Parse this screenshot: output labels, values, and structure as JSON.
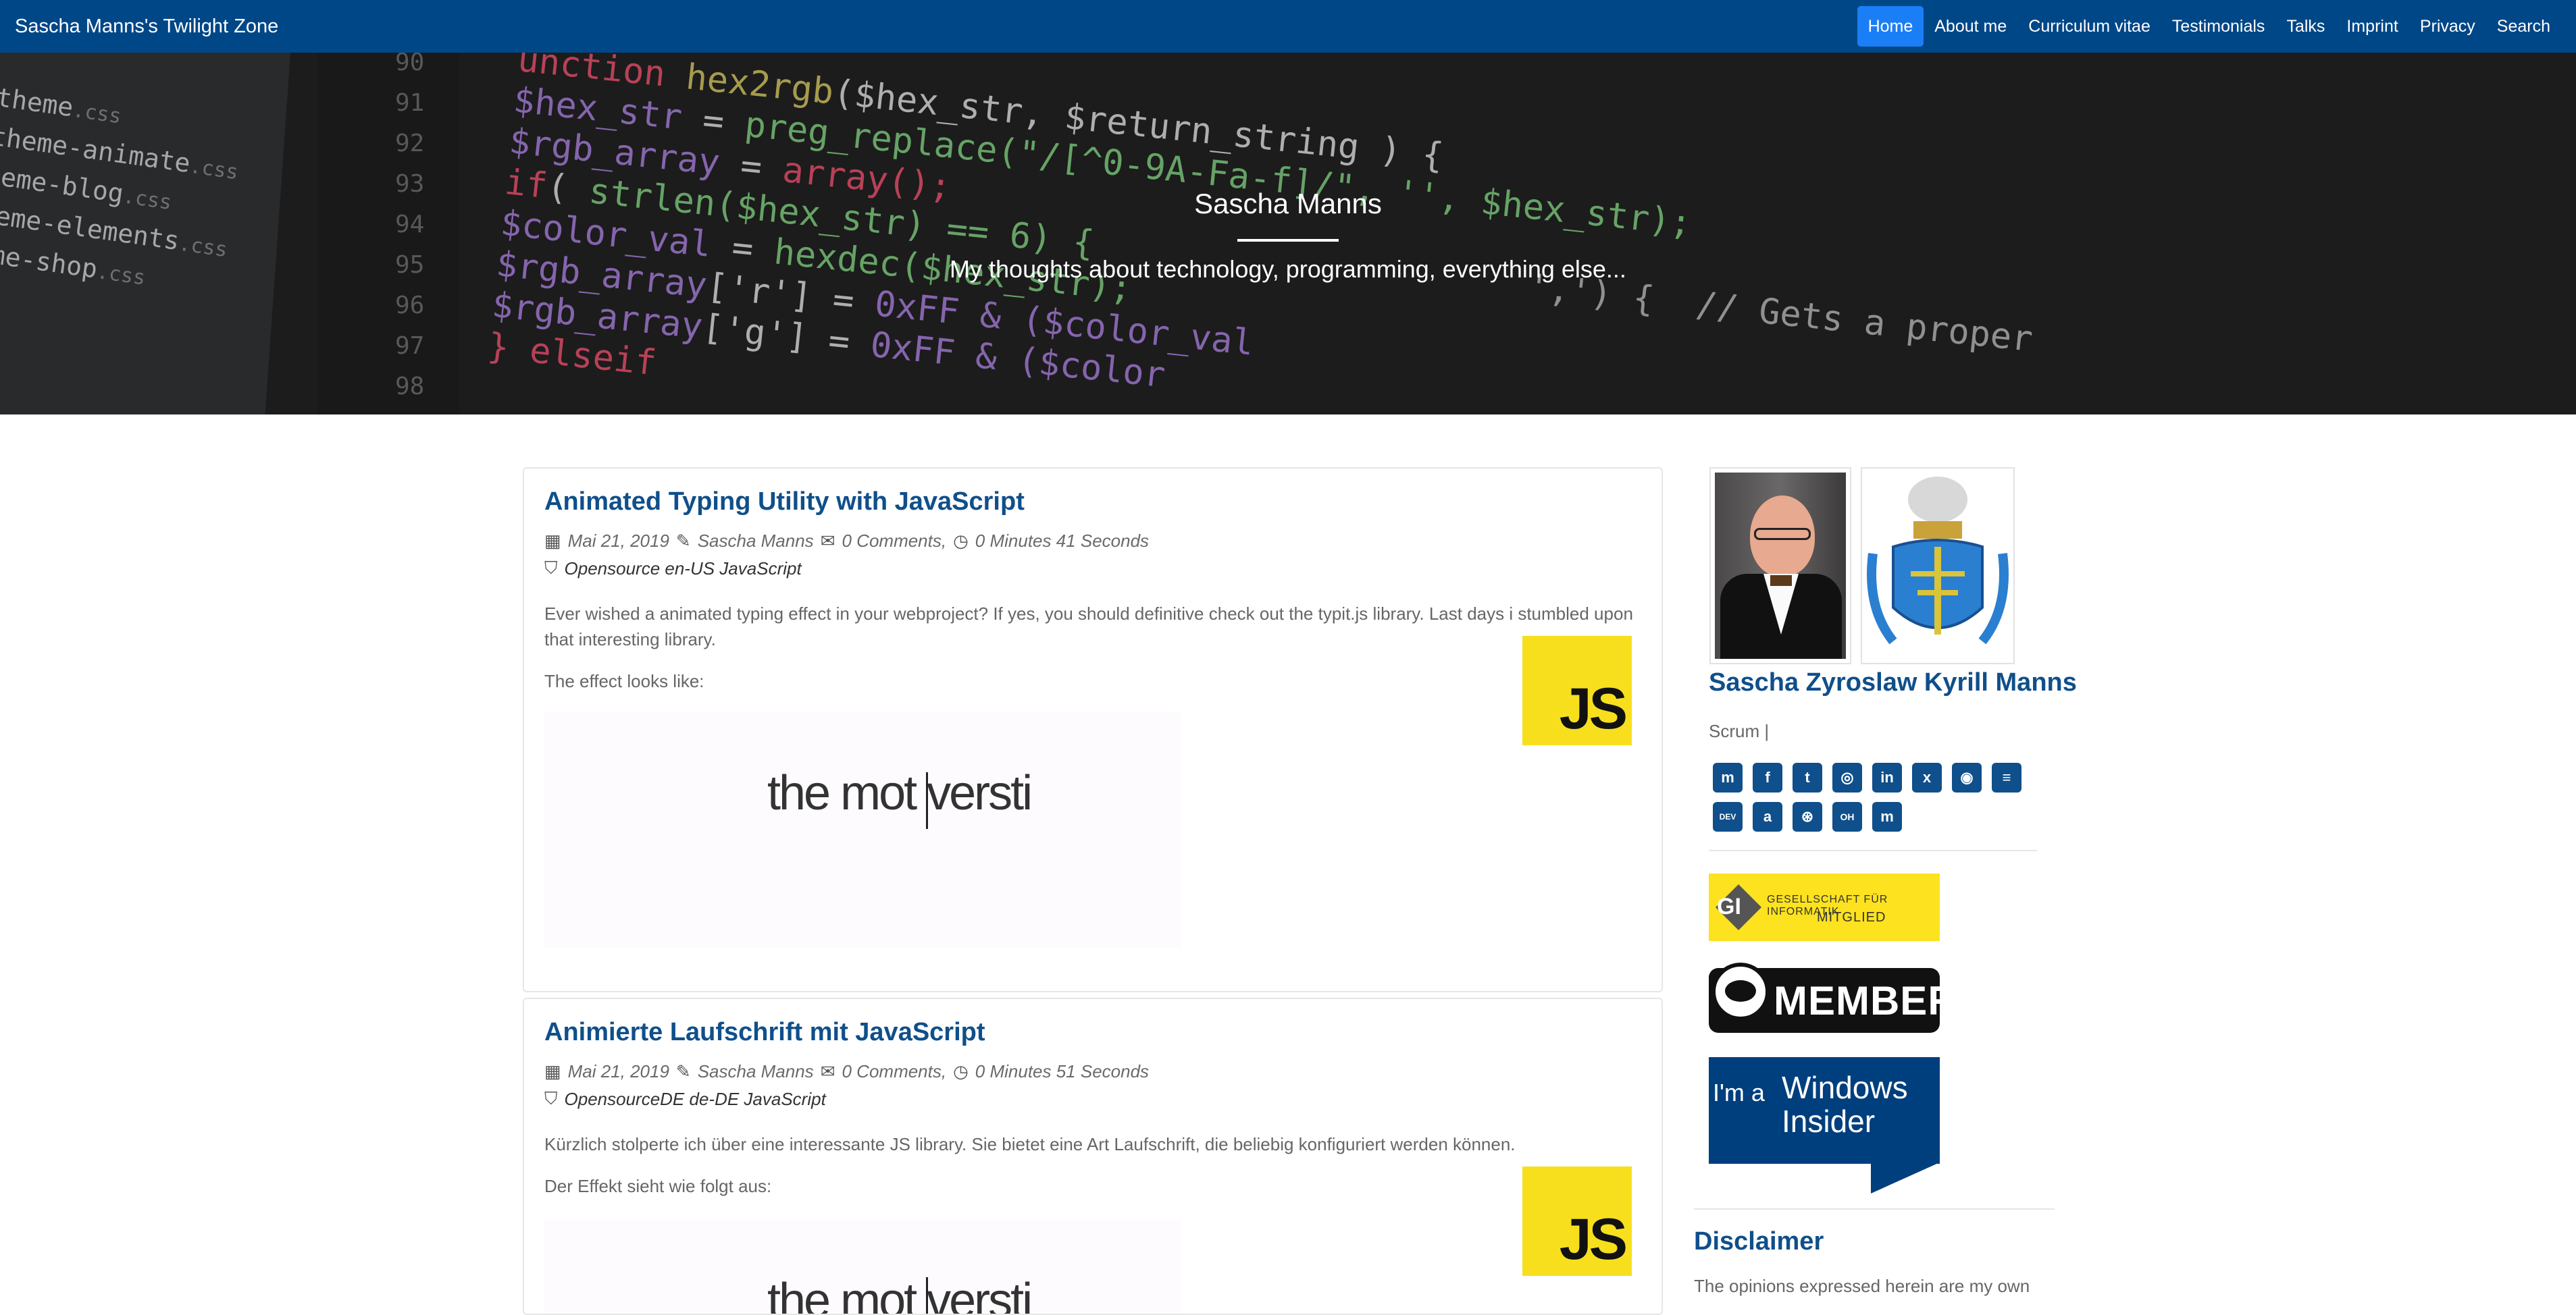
{
  "navbar": {
    "brand": "Sascha Manns's Twilight Zone",
    "items": [
      {
        "label": "Home",
        "active": true
      },
      {
        "label": "About me"
      },
      {
        "label": "Curriculum vitae"
      },
      {
        "label": "Testimonials"
      },
      {
        "label": "Talks"
      },
      {
        "label": "Imprint"
      },
      {
        "label": "Privacy"
      },
      {
        "label": "Search"
      }
    ]
  },
  "hero": {
    "title": "Sascha Manns",
    "subtitle": "My thoughts about technology, programming, everything else...",
    "files": [
      {
        "name": "theme",
        "ext": ".css"
      },
      {
        "name": "theme-animate",
        "ext": ".css"
      },
      {
        "name": "heme-blog",
        "ext": ".css"
      },
      {
        "name": "heme-elements",
        "ext": ".css"
      },
      {
        "name": "eme-shop",
        "ext": ".css"
      }
    ],
    "line_numbers": [
      "90",
      "91",
      "92",
      "93",
      "94",
      "95",
      "96",
      "97",
      "98"
    ],
    "code": [
      {
        "a": "unction ",
        "b": "hex2rgb",
        "c": "($hex_str, $return_string ) {"
      },
      {
        "a": "$hex_str",
        "b": " = ",
        "c": "preg_replace(\"/[^0-9A-Fa-f]/\", '', $hex_str);"
      },
      {
        "a": "$rgb_array",
        "b": " = ",
        "c": "array();"
      },
      {
        "a": "if",
        "b": "( ",
        "c": "strlen($hex_str) == 6) {"
      },
      {
        "a": "$color_val",
        "b": " = ",
        "c": "hexdec($hex_str);"
      },
      {
        "a": "$rgb_array",
        "b": "['r'] = ",
        "c": "0xFF & ($color_val"
      },
      {
        "a": "$rgb_array",
        "b": "['g'] = ",
        "c": "0xFF & ($color"
      },
      {
        "a": "} elseif",
        "b": "",
        "c": ""
      }
    ],
    "code_tail": "',') {  // Gets a proper"
  },
  "posts": [
    {
      "title": "Animated Typing Utility with JavaScript",
      "date": "Mai 21, 2019",
      "author": "Sascha Manns",
      "comments": "0 Comments,",
      "duration": "0 Minutes 41 Seconds",
      "tags": "Opensource en-US JavaScript",
      "excerpt": "Ever wished a animated typing effect in your webproject? If yes, you should definitive check out the typit.js library. Last days i stumbled upon that interesting library.",
      "effect_label": "The effect looks like:",
      "badge": "JS",
      "gif_text": "the mot versti"
    },
    {
      "title": "Animierte Laufschrift mit JavaScript",
      "date": "Mai 21, 2019",
      "author": "Sascha Manns",
      "comments": "0 Comments,",
      "duration": "0 Minutes 51 Seconds",
      "tags": "OpensourceDE de-DE JavaScript",
      "excerpt": "Kürzlich stolperte ich über eine interessante JS library. Sie bietet eine Art Laufschrift, die beliebig konfiguriert werden können.",
      "effect_label": "Der Effekt sieht wie folgt aus:",
      "badge": "JS",
      "gif_text": "the mot versti"
    }
  ],
  "sidebar": {
    "name": "Sascha Zyroslaw Kyrill Manns",
    "role": "Scrum |",
    "social": [
      "mastodon-icon",
      "facebook-icon",
      "twitter-icon",
      "instagram-icon",
      "linkedin-icon",
      "xing-icon",
      "github-icon",
      "stackoverflow-icon",
      "dev-icon",
      "amazon-icon",
      "steam-icon",
      "openhub-icon",
      "meetup-icon"
    ],
    "social_glyphs": [
      "m",
      "f",
      "t",
      "◎",
      "in",
      "x",
      "◉",
      "≡",
      "DEV",
      "a",
      "⊛",
      "OH",
      "m"
    ],
    "gi": {
      "logo": "GI",
      "line1": "GESELLSCHAFT FÜR INFORMATIK",
      "line2": "MITGLIED"
    },
    "member": "MEMBER",
    "insider": {
      "im": "I'm a",
      "w1": "Windows",
      "w2": "Insider"
    },
    "disclaimer_title": "Disclaimer",
    "disclaimer_text": "The opinions expressed herein are my own"
  },
  "colors": {
    "navbar": "#004787",
    "active": "#1a7ef7",
    "title": "#0f4f8b",
    "js_yellow": "#f7df1e"
  }
}
